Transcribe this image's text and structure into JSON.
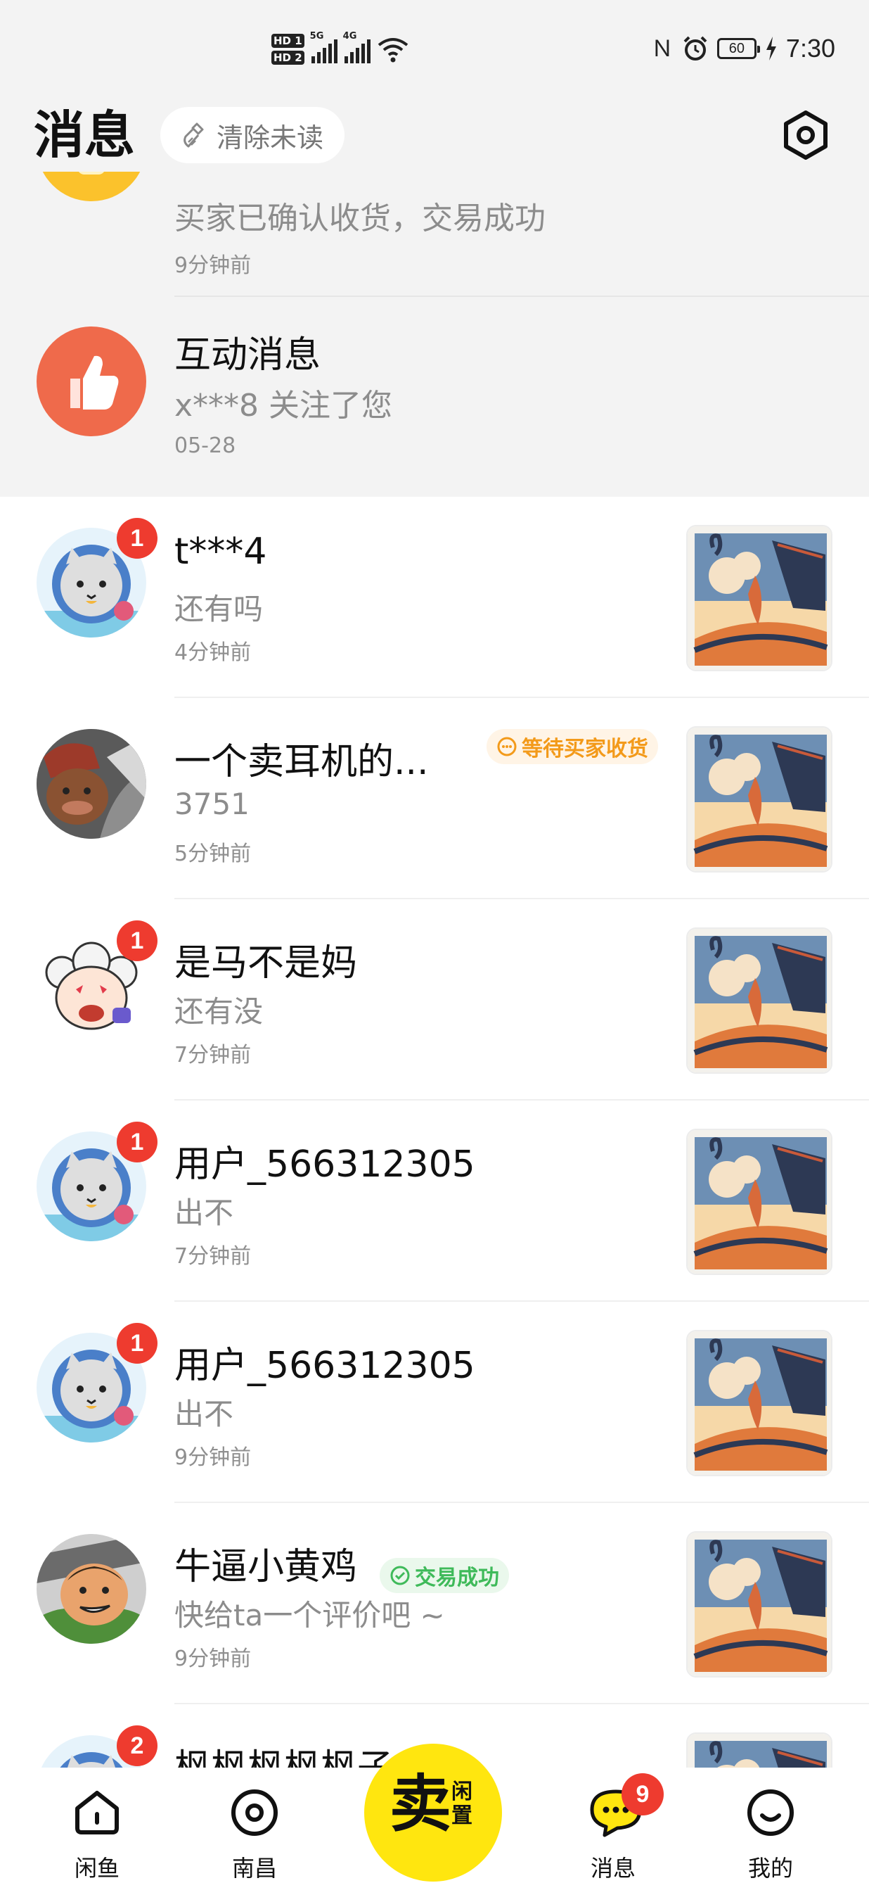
{
  "status_bar": {
    "hd1": "HD 1",
    "hd2": "HD 2",
    "net1": "5G",
    "net2": "4G",
    "battery": "60",
    "time": "7:30"
  },
  "header": {
    "title": "消息",
    "clear_label": "清除未读"
  },
  "system": [
    {
      "message": "买家已确认收货，交易成功",
      "time": "9分钟前"
    },
    {
      "title": "互动消息",
      "message": "x***8 关注了您",
      "time": "05-28"
    }
  ],
  "conversations": [
    {
      "name": "t***4",
      "message": "还有吗",
      "time": "4分钟前",
      "badge": "1",
      "avatar": "cat-avatar"
    },
    {
      "name": "一个卖耳机的...",
      "message": "3751",
      "time": "5分钟前",
      "tag": "等待买家收货",
      "avatar": "photo-avatar"
    },
    {
      "name": "是马不是妈",
      "message": "还有没",
      "time": "7分钟前",
      "badge": "1",
      "avatar": "sheep-avatar"
    },
    {
      "name": "用户_566312305",
      "message": "出不",
      "time": "7分钟前",
      "badge": "1",
      "avatar": "cat-avatar"
    },
    {
      "name": "用户_566312305",
      "message": "出不",
      "time": "9分钟前",
      "badge": "1",
      "avatar": "cat-avatar"
    },
    {
      "name": "牛逼小黄鸡",
      "message": "快给ta一个评价吧 ~",
      "time": "9分钟前",
      "tag": "交易成功",
      "avatar": "cartoon-avatar"
    },
    {
      "name": "枫枫枫枫枫子",
      "badge": "2",
      "avatar": "cat-avatar"
    }
  ],
  "tabbar": {
    "tabs": [
      "闲鱼",
      "南昌",
      "消息",
      "我的"
    ],
    "sell_big": "卖",
    "sell_small": "闲置",
    "message_badge": "9"
  },
  "colors": {
    "brand_yellow": "#ffe60f",
    "badge_red": "#ee3b2f",
    "interaction_orange": "#ef6a4b",
    "tag_orange": "#f39a1a",
    "tag_green": "#3fba5a"
  }
}
